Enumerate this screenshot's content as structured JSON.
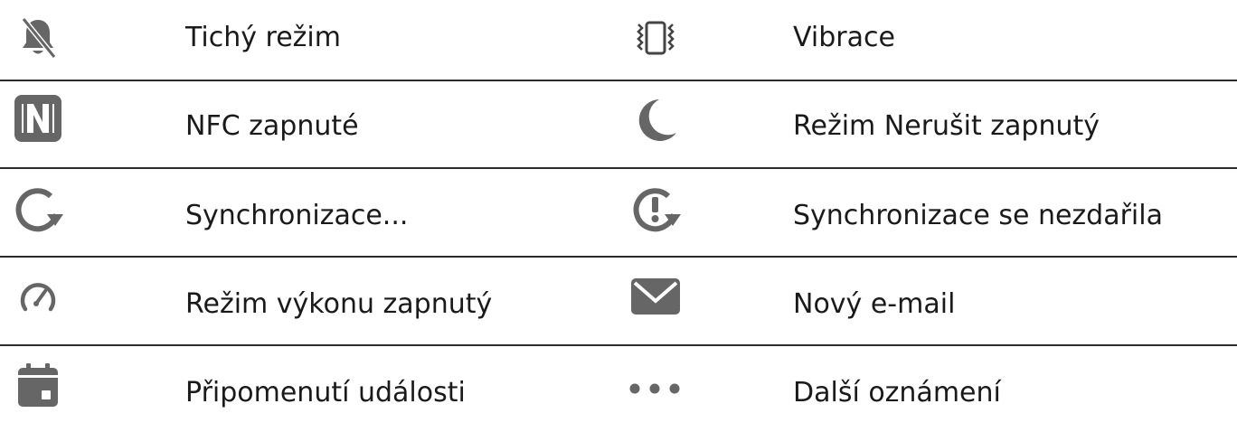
{
  "colors": {
    "icon": "#666666",
    "text": "#1a1a1a",
    "divider": "#2b2b2b"
  },
  "rows": [
    {
      "left": {
        "icon": "bell-off-icon",
        "label": "Tichý režim"
      },
      "right": {
        "icon": "vibration-icon",
        "label": "Vibrace"
      }
    },
    {
      "left": {
        "icon": "nfc-icon",
        "label": "NFC zapnuté"
      },
      "right": {
        "icon": "moon-icon",
        "label": "Režim Nerušit zapnutý"
      }
    },
    {
      "left": {
        "icon": "sync-icon",
        "label": "Synchronizace..."
      },
      "right": {
        "icon": "sync-failed-icon",
        "label": "Synchronizace se nezdařila"
      }
    },
    {
      "left": {
        "icon": "speedometer-icon",
        "label": "Režim výkonu zapnutý"
      },
      "right": {
        "icon": "mail-icon",
        "label": "Nový e-mail"
      }
    },
    {
      "left": {
        "icon": "calendar-icon",
        "label": "Připomenutí události"
      },
      "right": {
        "icon": "more-dots-icon",
        "label": "Další oznámení"
      }
    }
  ]
}
